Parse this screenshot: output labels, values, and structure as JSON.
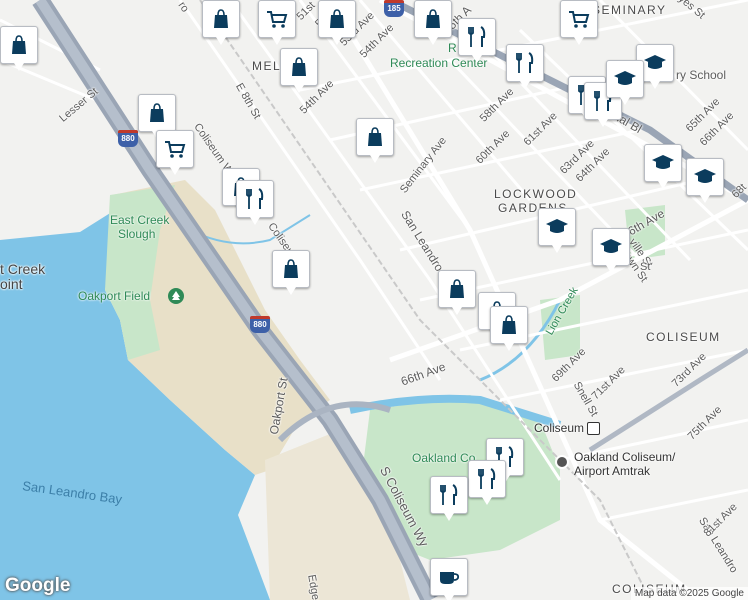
{
  "map": {
    "attribution": "Map data ©2025 Google",
    "logo": "Google",
    "colors": {
      "water": "#7fc4e7",
      "park": "#c8e6c9",
      "road": "#ffffff",
      "highway": "#9aa5b5",
      "poi_pin": "#0b3c5d"
    },
    "labels": {
      "seminary_area": "SEMINARY",
      "melrose_area": "MEL",
      "lockwood_line1": "LOCKWOOD",
      "lockwood_line2": "GARDENS",
      "coliseum_area": "COLISEUM",
      "coliseum_bottom": "COLISEUM",
      "recreation_line1": "R",
      "recreation_line2": "Recreation Center",
      "school": "ry School",
      "international_blvd": "International Bl",
      "seminary_ave": "Seminary Ave",
      "san_leandro": "San Leandro",
      "san_leandro_se": "San Leandro",
      "ave_66th": "66th Ave",
      "ave_66th_lower": "66th Ave",
      "ave_69th": "69th Ave",
      "ave_71st": "71st Ave",
      "ave_73rd": "73rd Ave",
      "ave_75th": "75th Ave",
      "ave_81st": "81st Ave",
      "ave_54th": "54th Ave",
      "ave_54th_upper": "54th Ave",
      "ave_55th": "55th A",
      "ave_53rd": "53rd Ave",
      "ave_52nd": "52nd",
      "ave_51st": "51st",
      "ave_58th": "58th Ave",
      "ave_60th": "60th Ave",
      "ave_61st": "61st Ave",
      "ave_63rd": "63rd Ave",
      "ave_64th": "64th Ave",
      "ave_65th": "65th Ave",
      "ave_66th_top": "66th Ave",
      "ave_68th": "68t",
      "e8th": "E 8th St",
      "lesser": "Lesser St",
      "coliseum_wy": "Coliseum Wy",
      "coliseum_short": "Coliseu",
      "oakport": "Oakport St",
      "s_coliseum_wy": "S Coliseum Wy",
      "edge": "Edge",
      "snell": "Snell St",
      "lion_creek": "Lion Creek",
      "hayes": "yes St",
      "ville": "ville St",
      "awn": "awn St",
      "ro": "ro",
      "st_label": "St",
      "east_creek_slough_1": "East Creek",
      "east_creek_slough_2": "Slough",
      "east_creek_point_1": "t Creek",
      "east_creek_point_2": "oint",
      "oakport_field": "Oakport Field",
      "oakland_co": "Oakland Co",
      "coliseum_station": "Coliseum",
      "amtrak_1": "Oakland Coliseum/",
      "amtrak_2": "Airport Amtrak",
      "san_leandro_bay": "San Leandro Bay",
      "hwy_880": "880",
      "hwy_880_b": "880",
      "hwy_185": "185"
    },
    "pins": [
      {
        "icon": "shopping-bag"
      },
      {
        "icon": "shopping-cart"
      },
      {
        "icon": "shopping-bag"
      },
      {
        "icon": "shopping-bag"
      },
      {
        "icon": "shopping-cart"
      },
      {
        "icon": "shopping-bag"
      },
      {
        "icon": "shopping-cart"
      },
      {
        "icon": "shopping-bag"
      },
      {
        "icon": "shopping-bag"
      },
      {
        "icon": "restaurant"
      },
      {
        "icon": "shopping-bag"
      },
      {
        "icon": "shopping-bag"
      },
      {
        "icon": "school"
      },
      {
        "icon": "school"
      },
      {
        "icon": "school"
      },
      {
        "icon": "school"
      },
      {
        "icon": "school"
      },
      {
        "icon": "shopping-bag"
      },
      {
        "icon": "shopping-bag"
      },
      {
        "icon": "shopping-bag"
      },
      {
        "icon": "restaurant"
      },
      {
        "icon": "restaurant"
      },
      {
        "icon": "restaurant"
      },
      {
        "icon": "restaurant"
      },
      {
        "icon": "restaurant"
      },
      {
        "icon": "restaurant"
      },
      {
        "icon": "restaurant"
      },
      {
        "icon": "cafe"
      },
      {
        "icon": "shopping-bag"
      },
      {
        "icon": "school"
      }
    ]
  }
}
